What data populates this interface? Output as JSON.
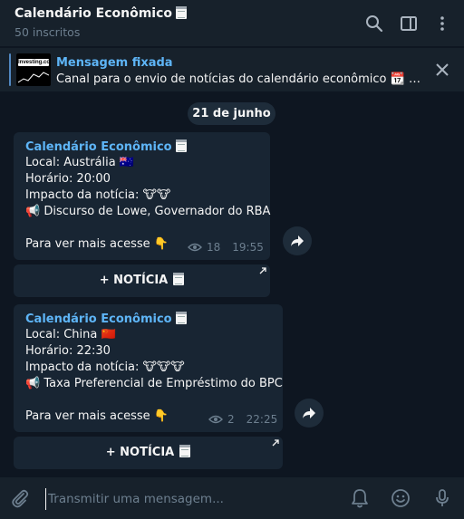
{
  "header": {
    "title": "Calendário Econômico",
    "subtitle": "50 inscritos",
    "icons": [
      "search-icon",
      "sidebar-toggle-icon",
      "more-vert-icon"
    ]
  },
  "pinned": {
    "title": "Mensagem fixada",
    "text": "Canal para o envio de notícias do calendário econômico 📆 …",
    "thumb_logo": "Investing.com"
  },
  "date_separator": "21 de junho",
  "messages": [
    {
      "author": "Calendário Econômico",
      "local": "Local: Austrália 🇦🇺",
      "horario": "Horário: 20:00",
      "impacto": "Impacto da notícia: 🐮🐮",
      "evento": "📢 Discurso de Lowe, Governador do RBA",
      "cta": "Para ver mais acesse 👇",
      "views": "18",
      "time": "19:55",
      "button": "+ NOTÍCIA"
    },
    {
      "author": "Calendário Econômico",
      "local": "Local: China 🇨🇳",
      "horario": "Horário: 22:30",
      "impacto": "Impacto da notícia: 🐮🐮🐮",
      "evento": "📢 Taxa Preferencial de Empréstimo do BPC",
      "cta": "Para ver mais acesse 👇",
      "views": "2",
      "time": "22:25",
      "button": "+ NOTÍCIA"
    }
  ],
  "composer": {
    "placeholder": "Transmitir uma mensagem..."
  },
  "colors": {
    "bg": "#0e1621",
    "panel": "#17212b",
    "bubble": "#182533",
    "accent": "#5eb5f7",
    "muted": "#6d7f8f"
  }
}
